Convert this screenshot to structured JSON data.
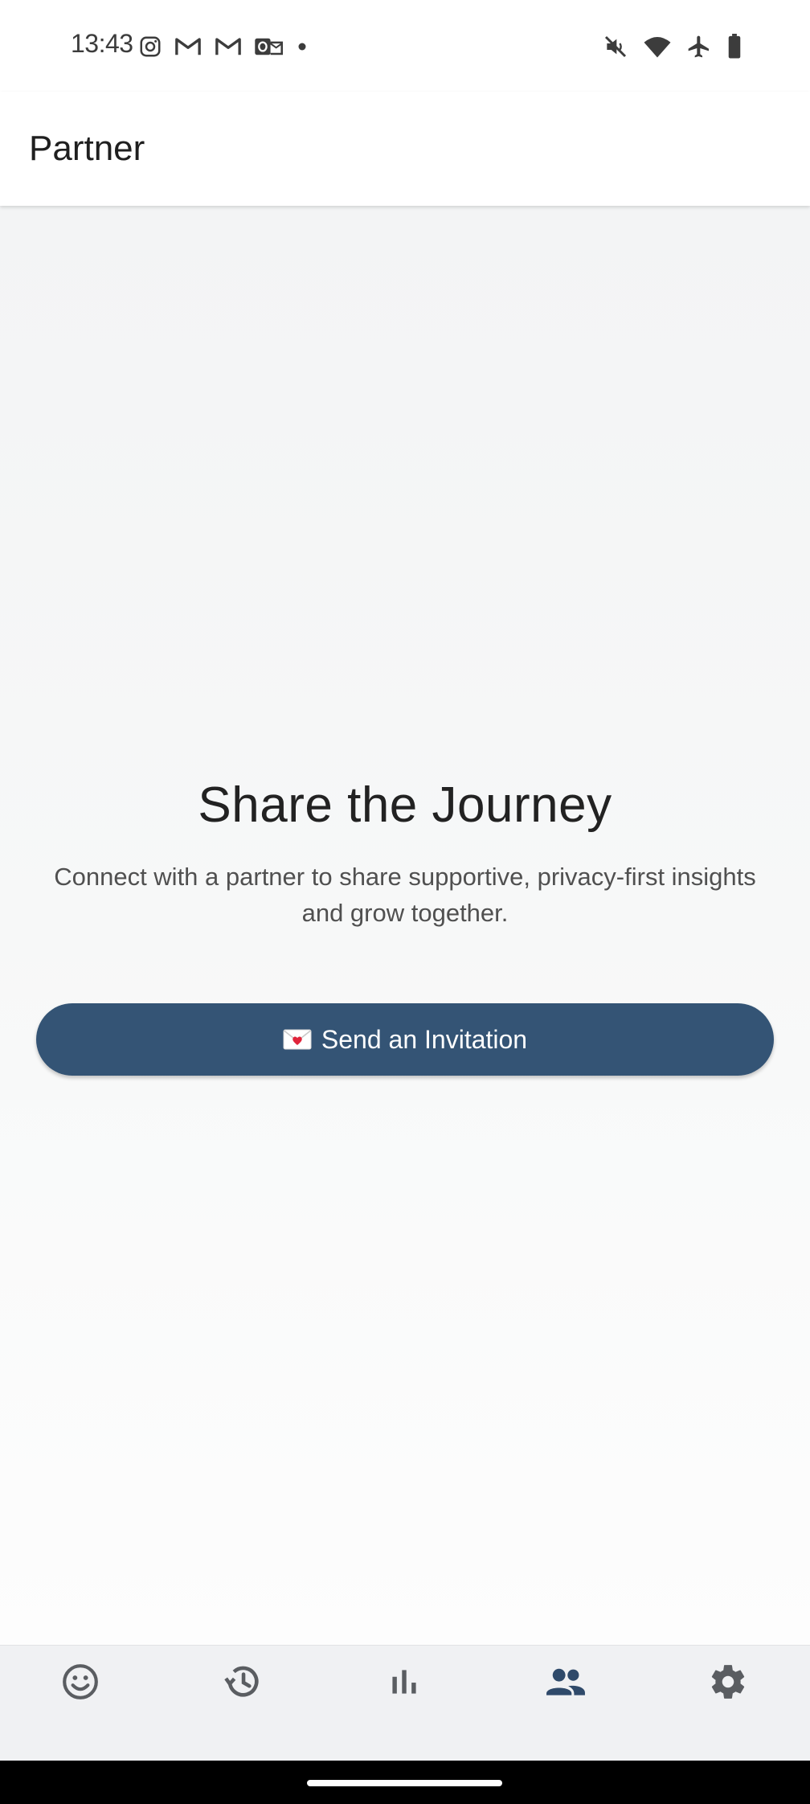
{
  "status_bar": {
    "time": "13:43",
    "left_icons": [
      "instagram-icon",
      "gmail-icon",
      "gmail-icon",
      "outlook-icon",
      "dot-icon"
    ],
    "right_icons": [
      "mute-icon",
      "wifi-icon",
      "airplane-icon",
      "battery-icon"
    ]
  },
  "app_bar": {
    "title": "Partner"
  },
  "main": {
    "title": "Share the Journey",
    "subtitle": "Connect with a partner to share supportive, privacy-first insights and grow together.",
    "invite_button": {
      "emoji": "💌",
      "label": "Send an Invitation"
    }
  },
  "bottom_nav": {
    "items": [
      {
        "icon": "smiley-icon",
        "active": false
      },
      {
        "icon": "history-icon",
        "active": false
      },
      {
        "icon": "bar-chart-icon",
        "active": false
      },
      {
        "icon": "people-icon",
        "active": true
      },
      {
        "icon": "gear-icon",
        "active": false
      }
    ]
  },
  "colors": {
    "accent": "#345475",
    "nav_active": "#2f4a6a",
    "nav_inactive": "#5a5d61",
    "background": "#f3f4f5"
  }
}
